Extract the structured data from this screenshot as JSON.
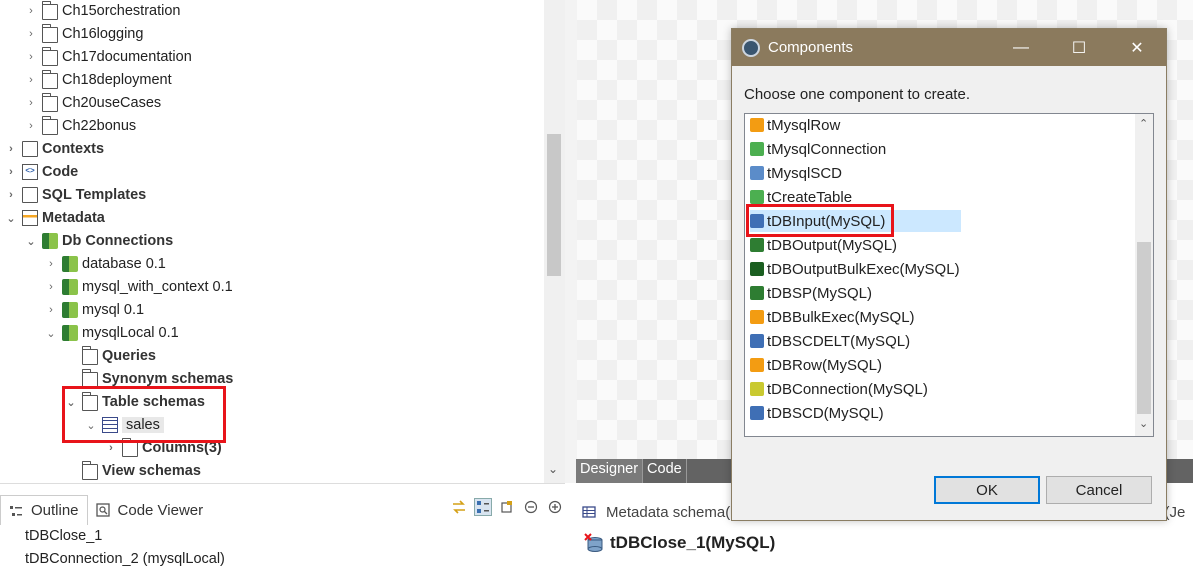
{
  "tree": {
    "items": [
      {
        "label": "Ch15orchestration",
        "chev": "›",
        "icon": "folder",
        "bold": false
      },
      {
        "label": "Ch16logging",
        "chev": "›",
        "icon": "folder",
        "bold": false
      },
      {
        "label": "Ch17documentation",
        "chev": "›",
        "icon": "folder",
        "bold": false
      },
      {
        "label": "Ch18deployment",
        "chev": "›",
        "icon": "folder",
        "bold": false
      },
      {
        "label": "Ch20useCases",
        "chev": "›",
        "icon": "folder",
        "bold": false
      },
      {
        "label": "Ch22bonus",
        "chev": "›",
        "icon": "folder",
        "bold": false
      },
      {
        "label": "Contexts",
        "chev": "›",
        "icon": "contexts",
        "bold": true
      },
      {
        "label": "Code",
        "chev": "›",
        "icon": "code",
        "bold": true
      },
      {
        "label": "SQL Templates",
        "chev": "›",
        "icon": "sql",
        "bold": true
      },
      {
        "label": "Metadata",
        "chev": "⌄",
        "icon": "metadata",
        "bold": true
      },
      {
        "label": "Db Connections",
        "chev": "⌄",
        "icon": "db",
        "bold": true
      },
      {
        "label": "database 0.1",
        "chev": "›",
        "icon": "db",
        "bold": false
      },
      {
        "label": "mysql_with_context 0.1",
        "chev": "›",
        "icon": "db",
        "bold": false
      },
      {
        "label": "mysql 0.1",
        "chev": "›",
        "icon": "db",
        "bold": false
      },
      {
        "label": "mysqlLocal 0.1",
        "chev": "⌄",
        "icon": "db",
        "bold": false
      },
      {
        "label": "Queries",
        "chev": "",
        "icon": "folder",
        "bold": true
      },
      {
        "label": "Synonym schemas",
        "chev": "",
        "icon": "folder",
        "bold": true
      },
      {
        "label": "Table schemas",
        "chev": "⌄",
        "icon": "folder",
        "bold": true
      },
      {
        "label": "sales",
        "chev": "⌄",
        "icon": "table",
        "bold": false
      },
      {
        "label": "Columns(3)",
        "chev": "›",
        "icon": "folder",
        "bold": true
      },
      {
        "label": "View schemas",
        "chev": "",
        "icon": "folder",
        "bold": true
      }
    ]
  },
  "designer": {
    "tabs": [
      "Designer",
      "Code"
    ]
  },
  "bottom_left": {
    "tabs": [
      "Outline",
      "Code Viewer"
    ],
    "outline_items": [
      "tDBClose_1",
      "tDBConnection_2 (mysqlLocal)"
    ]
  },
  "bottom_right": {
    "tab_label": "Metadata schema(",
    "tab_right_label": "n (Je",
    "component_title": "tDBClose_1(MySQL)"
  },
  "dialog": {
    "title": "Components",
    "prompt": "Choose one component to create.",
    "items": [
      {
        "label": "tMysqlRow",
        "color": "#f39c12"
      },
      {
        "label": "tMysqlConnection",
        "color": "#4caf50"
      },
      {
        "label": "tMysqlSCD",
        "color": "#5b8cc9"
      },
      {
        "label": "tCreateTable",
        "color": "#4caf50"
      },
      {
        "label": "tDBInput(MySQL)",
        "color": "#3f6fb5"
      },
      {
        "label": "tDBOutput(MySQL)",
        "color": "#2e7d32"
      },
      {
        "label": "tDBOutputBulkExec(MySQL)",
        "color": "#1a5e20"
      },
      {
        "label": "tDBSP(MySQL)",
        "color": "#2e7d32"
      },
      {
        "label": "tDBBulkExec(MySQL)",
        "color": "#f39c12"
      },
      {
        "label": "tDBSCDELT(MySQL)",
        "color": "#3f6fb5"
      },
      {
        "label": "tDBRow(MySQL)",
        "color": "#f39c12"
      },
      {
        "label": "tDBConnection(MySQL)",
        "color": "#c9c930"
      },
      {
        "label": "tDBSCD(MySQL)",
        "color": "#3f6fb5"
      }
    ],
    "selected_index": 4,
    "ok_label": "OK",
    "cancel_label": "Cancel",
    "min_symbol": "—",
    "max_symbol": "☐",
    "close_symbol": "✕"
  }
}
